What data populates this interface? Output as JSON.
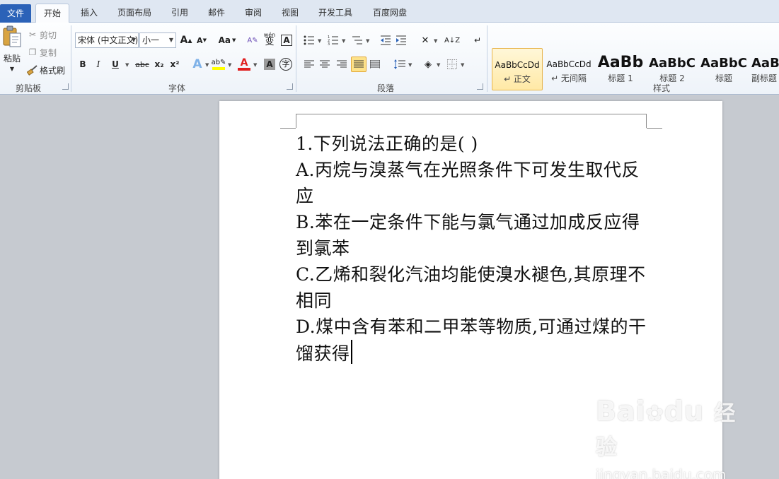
{
  "tabs": [
    {
      "label": "文件",
      "id": "file"
    },
    {
      "label": "开始",
      "id": "home"
    },
    {
      "label": "插入",
      "id": "insert"
    },
    {
      "label": "页面布局",
      "id": "layout"
    },
    {
      "label": "引用",
      "id": "references"
    },
    {
      "label": "邮件",
      "id": "mailings"
    },
    {
      "label": "审阅",
      "id": "review"
    },
    {
      "label": "视图",
      "id": "view"
    },
    {
      "label": "开发工具",
      "id": "developer"
    },
    {
      "label": "百度网盘",
      "id": "baidu"
    }
  ],
  "clipboard": {
    "group_label": "剪贴板",
    "paste": "粘贴",
    "cut": "剪切",
    "copy": "复制",
    "format_painter": "格式刷"
  },
  "font": {
    "group_label": "字体",
    "name": "宋体 (中文正文)",
    "size": "小一",
    "change_case": "Aa",
    "bold": "B",
    "italic": "I",
    "underline": "U",
    "strikethrough": "abc",
    "subscript": "x₂",
    "superscript": "x²",
    "pinyin": "wén",
    "pinyin_char": "变",
    "border_char": "A",
    "enclose_char": "字",
    "grow": "A",
    "shrink": "A",
    "highlight_color": "#ffff00",
    "font_color": "#e02020"
  },
  "paragraph": {
    "group_label": "段落"
  },
  "styles": {
    "group_label": "样式",
    "items": [
      {
        "sample": "AaBbCcDd",
        "name": "↵ 正文",
        "selected": true
      },
      {
        "sample": "AaBbCcDd",
        "name": "↵ 无间隔",
        "selected": false
      },
      {
        "sample": "AaBb",
        "name": "标题 1",
        "selected": false
      },
      {
        "sample": "AaBbC",
        "name": "标题 2",
        "selected": false
      },
      {
        "sample": "AaBbC",
        "name": "标题",
        "selected": false
      },
      {
        "sample": "AaBb",
        "name": "副标题",
        "selected": false
      }
    ]
  },
  "document": {
    "lines": [
      "1.下列说法正确的是( )",
      "A.丙烷与溴蒸气在光照条件下可发生取代反应",
      "B.苯在一定条件下能与氯气通过加成反应得到氯苯",
      "C.乙烯和裂化汽油均能使溴水褪色,其原理不相同",
      "D.煤中含有苯和二甲苯等物质,可通过煤的干馏获得"
    ]
  },
  "watermark": {
    "brand": "Bai",
    "brand2": "du",
    "cn": "经验",
    "url": "jingyan.baidu.com"
  }
}
